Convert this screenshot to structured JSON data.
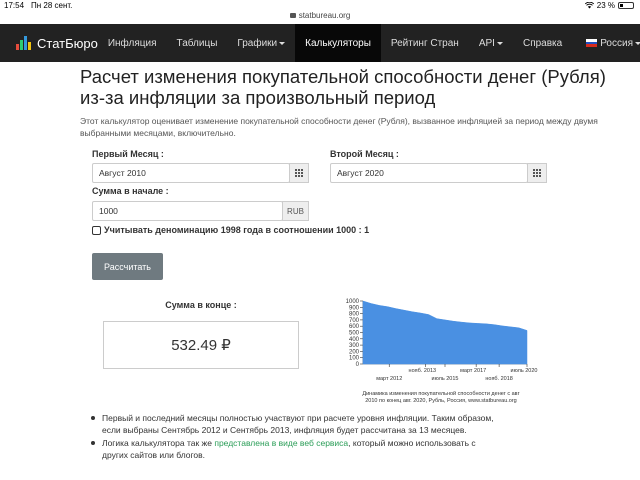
{
  "status_bar": {
    "time": "17:54",
    "date": "Пн 28 сент.",
    "wifi_icon": "wifi-icon",
    "battery": "23 %"
  },
  "browser": {
    "url": "statbureau.org"
  },
  "nav": {
    "brand": "СтатБюро",
    "items": [
      {
        "label": "Инфляция",
        "dropdown": false
      },
      {
        "label": "Таблицы",
        "dropdown": false
      },
      {
        "label": "Графики",
        "dropdown": true
      },
      {
        "label": "Калькуляторы",
        "dropdown": false,
        "active": true
      },
      {
        "label": "Рейтинг Стран",
        "dropdown": false
      },
      {
        "label": "API",
        "dropdown": true
      },
      {
        "label": "Справка",
        "dropdown": false
      }
    ],
    "language": "Россия"
  },
  "page": {
    "title_line1": "Расчет изменения покупательной способности денег (Рубля)",
    "title_line2": "из-за инфляции за произвольный период",
    "intro_line1": "Этот калькулятор оценивает изменение покупательной способности денег (Рубля), вызванное инфляцией за период между двумя",
    "intro_line2": "выбранными месяцами, включительно."
  },
  "form": {
    "first_month_label": "Первый Месяц :",
    "first_month_value": "Август 2010",
    "second_month_label": "Второй Месяц :",
    "second_month_value": "Август 2020",
    "amount_label": "Сумма в начале :",
    "amount_value": "1000",
    "currency": "RUB",
    "denomination_label": "Учитывать деноминацию 1998 года в соотношении 1000 : 1",
    "denomination_checked": false,
    "calculate_button": "Рассчитать"
  },
  "result": {
    "label": "Сумма в конце :",
    "value": "532.49 ₽"
  },
  "chart_data": {
    "type": "area",
    "caption": "Динамика изменения покупательной способности денег с авг 2010 по конец авг. 2020, Рубль, Россия, www.statbureau.org",
    "caption_lines": [
      "Динамика изменения покупательной способности денег с авг",
      "2010 по конец авг. 2020, Рубль, Россия, www.statbureau.org"
    ],
    "ylim": [
      0,
      1000
    ],
    "yticks": [
      "1000",
      "900",
      "800",
      "700",
      "600",
      "500",
      "400",
      "300",
      "200",
      "100",
      "0"
    ],
    "xticks_upper": [
      "нояб. 2013",
      "март 2017",
      "июль 2020"
    ],
    "xticks_lower": [
      "март 2012",
      "июль 2015",
      "нояб. 2018"
    ],
    "color": "#4a90e2",
    "x": [
      "2010-08",
      "2011-02",
      "2011-08",
      "2012-02",
      "2012-08",
      "2013-02",
      "2013-08",
      "2014-02",
      "2014-08",
      "2015-02",
      "2015-08",
      "2016-02",
      "2016-08",
      "2017-02",
      "2017-08",
      "2018-02",
      "2018-08",
      "2019-02",
      "2019-08",
      "2020-02",
      "2020-08"
    ],
    "values": [
      1000,
      960,
      930,
      910,
      880,
      855,
      830,
      810,
      785,
      720,
      700,
      680,
      665,
      652,
      645,
      638,
      625,
      605,
      590,
      575,
      532.49
    ]
  },
  "notes": {
    "bullet1_line1": "Первый и последний месяцы полностью участвуют при расчете уровня инфляции. Таким образом,",
    "bullet1_line2": "если выбраны Сентябрь 2012 и Сентябрь 2013, инфляция будет рассчитана за 13 месяцев.",
    "bullet2_prefix": "Логика калькулятора так же ",
    "bullet2_link": "представлена в виде веб сервиса",
    "bullet2_suffix": ", который можно использовать с",
    "bullet2_line2": "других сайтов или блогов."
  }
}
